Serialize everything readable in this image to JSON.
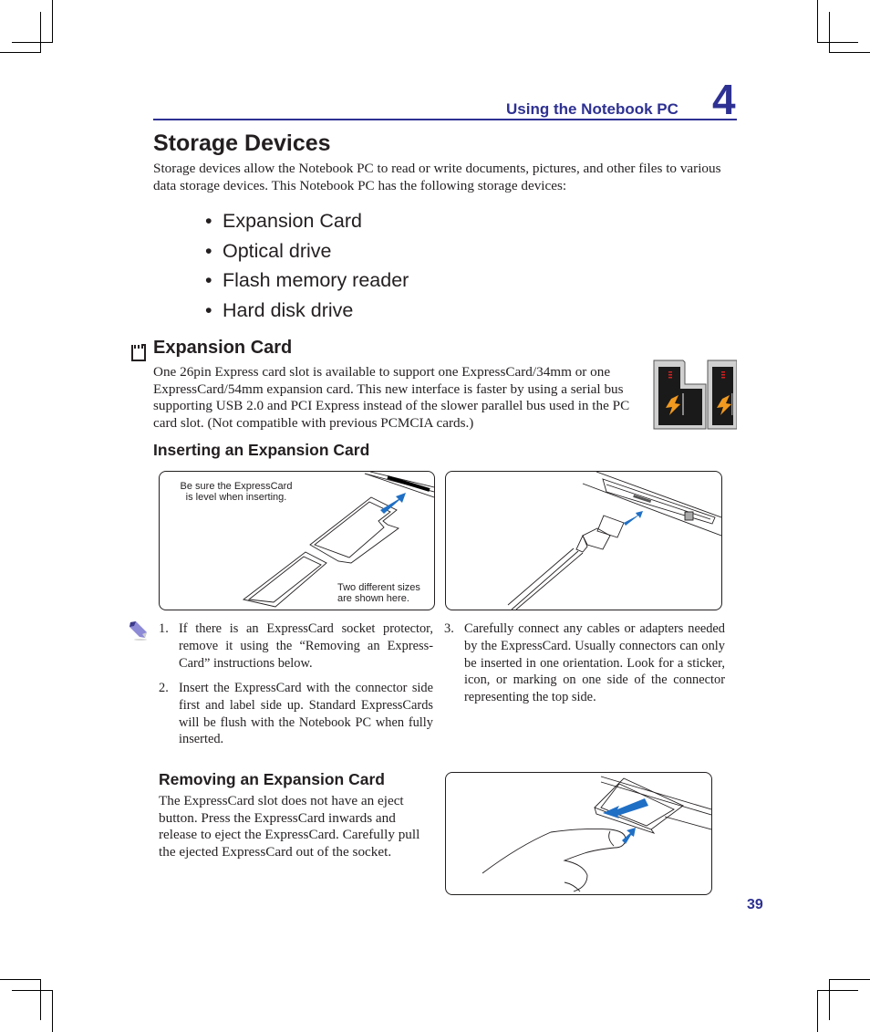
{
  "header": {
    "chapter_title": "Using the Notebook PC",
    "chapter_number": "4",
    "accent_color": "#2e3192"
  },
  "storage": {
    "title": "Storage Devices",
    "intro": "Storage devices allow the Notebook PC to read or write documents, pictures, and other files to various data storage devices. This Notebook PC has the following storage devices:",
    "bullet_glyph": "•",
    "devices": [
      "Expansion Card",
      "Optical drive",
      "Flash memory reader",
      "Hard disk drive"
    ]
  },
  "expansion_card": {
    "icon": "expresscard-slot-icon",
    "title": "Expansion Card",
    "description": "One 26pin Express card slot is available to support one ExpressCard/34mm or one ExpressCard/54mm expansion card. This new interface is faster by using a serial bus supporting USB 2.0 and PCI Express instead of the slower parallel bus used in the PC card slot. (Not compatible with previous PCMCIA cards.)",
    "photo_alt": "ExpressCard/54 and ExpressCard/34 cards"
  },
  "inserting": {
    "title": "Inserting an Expansion Card",
    "figure_left": {
      "label_top": "Be sure the ExpressCard is level when inserting.",
      "label_top_line1": "Be sure the ExpressCard",
      "label_top_line2": "is level when inserting.",
      "label_bottom_line1": "Two different sizes",
      "label_bottom_line2": "are shown here."
    },
    "note_icon": "pencil-note-icon",
    "steps": [
      {
        "num": "1.",
        "text": "If there is an ExpressCard socket protector, remove it using the “Removing an Express-Card” instructions below."
      },
      {
        "num": "2.",
        "text": "Insert the ExpressCard with the connector side first and label side up. Standard ExpressCards will be flush with the Notebook PC when fully inserted."
      },
      {
        "num": "3.",
        "text": "Carefully connect any cables or adapters needed by the ExpressCard. Usually connectors can only be inserted in one orientation. Look for a sticker, icon, or marking on one side of the connector representing the top side."
      }
    ]
  },
  "removing": {
    "title": "Removing an Expansion Card",
    "text": "The ExpressCard slot does not have an eject button. Press the ExpressCard inwards and release to eject the ExpressCard. Carefully pull the ejected ExpressCard out of the socket."
  },
  "footer": {
    "page_number": "39"
  },
  "colors": {
    "arrow_blue": "#1f6fc5",
    "card_black": "#1a1a1a",
    "card_logo_orange": "#f29a1f"
  }
}
